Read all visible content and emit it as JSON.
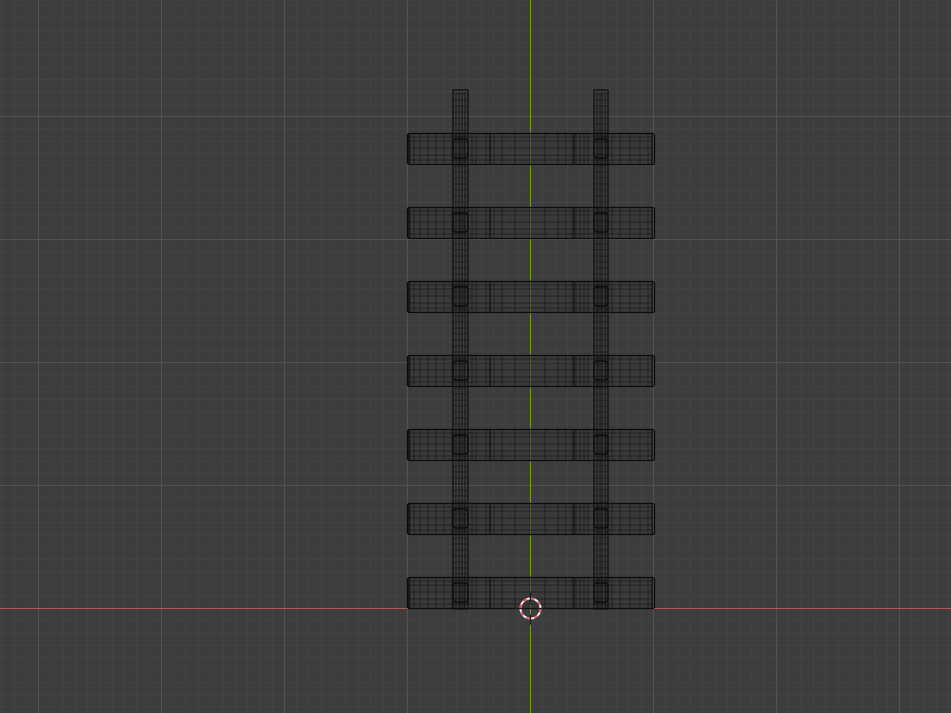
{
  "viewport": {
    "view": "top-orthographic",
    "shading": "wireframe",
    "grid": true
  },
  "colors": {
    "background": "#3d3d3d",
    "grid_minor": "#444444",
    "grid_major": "#525252",
    "x_axis": "#b0535e",
    "y_axis": "#6f9a34",
    "wire": "#0c0c0c",
    "cursor_red": "#e06060",
    "cursor_white": "#f2f2f2"
  },
  "scene": {
    "objects": [
      {
        "name": "ladder-rail-left",
        "type": "mesh"
      },
      {
        "name": "ladder-rail-right",
        "type": "mesh"
      },
      {
        "name": "ladder-rungs",
        "type": "mesh",
        "count": 7
      }
    ],
    "cursor": "3d-cursor"
  }
}
